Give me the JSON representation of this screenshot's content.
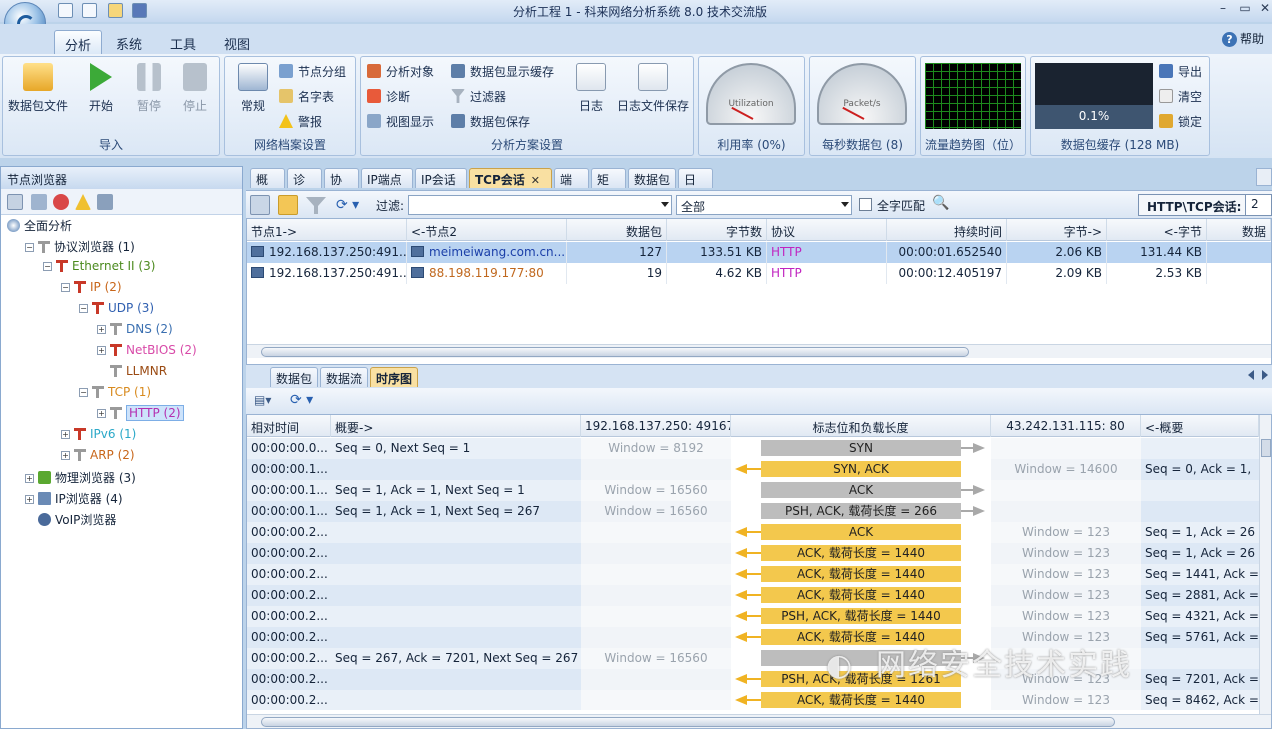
{
  "app": {
    "title": "分析工程 1 - 科来网络分析系统 8.0 技术交流版",
    "help": "帮助"
  },
  "ribbon_tabs": [
    "分析",
    "系统",
    "工具",
    "视图"
  ],
  "ribbon": {
    "import": {
      "label": "导入",
      "buttons": [
        "数据包文件",
        "开始",
        "暂停",
        "停止"
      ]
    },
    "profile": {
      "label": "网络档案设置",
      "big": "常规",
      "small": [
        "节点分组",
        "名字表",
        "警报"
      ]
    },
    "scheme": {
      "label": "分析方案设置",
      "col1": [
        "分析对象",
        "诊断",
        "视图显示"
      ],
      "col2": [
        "数据包显示缓存",
        "过滤器",
        "数据包保存"
      ],
      "big": [
        "日志",
        "日志文件保存"
      ]
    },
    "util": {
      "label": "利用率 (0%)",
      "gauge": "Utilization",
      "scale": [
        "0",
        "20",
        "40",
        "60",
        "80",
        "100"
      ],
      "value": 0
    },
    "pps": {
      "label": "每秒数据包 (8)",
      "gauge": "Packet/s",
      "scale": [
        "0",
        "500",
        "1K",
        "500K",
        "1M"
      ],
      "value": 8
    },
    "trend": {
      "label": "流量趋势图（位）"
    },
    "buffer": {
      "label": "数据包缓存 (128 MB)",
      "value": "0.1%",
      "fraction": 0.001,
      "actions": [
        "导出",
        "清空",
        "锁定"
      ]
    }
  },
  "left": {
    "title": "节点浏览器",
    "tree": [
      {
        "label": "全面分析",
        "level": 0,
        "icon": "globe-icon",
        "color": "#15243a",
        "ex": ""
      },
      {
        "label": "协议浏览器 (1)",
        "level": 1,
        "icon": "tee-icon",
        "color": "#15243a",
        "ex": "−"
      },
      {
        "label": "Ethernet II (3)",
        "level": 2,
        "icon": "tee-icon",
        "color": "#4b8a1e",
        "ex": "−"
      },
      {
        "label": "IP (2)",
        "level": 3,
        "icon": "tee-icon",
        "color": "#c8661a",
        "ex": "−"
      },
      {
        "label": "UDP (3)",
        "level": 4,
        "icon": "tee-icon",
        "color": "#2f5fb0",
        "ex": "−"
      },
      {
        "label": "DNS (2)",
        "level": 5,
        "icon": "tee-icon",
        "color": "#3a6fb0",
        "ex": "+"
      },
      {
        "label": "NetBIOS (2)",
        "level": 5,
        "icon": "tee-icon",
        "color": "#d84aa8",
        "ex": "+"
      },
      {
        "label": "LLMNR",
        "level": 5,
        "icon": "tee-icon",
        "color": "#9a4a12",
        "ex": ""
      },
      {
        "label": "TCP (1)",
        "level": 4,
        "icon": "tee-icon",
        "color": "#d88a1e",
        "ex": "−"
      },
      {
        "label": "HTTP (2)",
        "level": 5,
        "icon": "tee-icon",
        "color": "#b42fb0",
        "ex": "+",
        "selected": true
      },
      {
        "label": "IPv6 (1)",
        "level": 3,
        "icon": "tee-icon",
        "color": "#2aa8c8",
        "ex": "+"
      },
      {
        "label": "ARP (2)",
        "level": 3,
        "icon": "tee-icon",
        "color": "#c8661a",
        "ex": "+"
      },
      {
        "label": "物理浏览器 (3)",
        "level": 1,
        "icon": "chip-icon",
        "color": "#15243a",
        "ex": "+"
      },
      {
        "label": "IP浏览器 (4)",
        "level": 1,
        "icon": "pc-icon",
        "color": "#15243a",
        "ex": "+"
      },
      {
        "label": "VoIP浏览器",
        "level": 1,
        "icon": "phone-icon",
        "color": "#15243a",
        "ex": ""
      }
    ]
  },
  "tabs": [
    "概要",
    "诊断",
    "协议",
    "IP端点",
    "IP会话",
    "TCP会话",
    "端口",
    "矩阵",
    "数据包",
    "日志"
  ],
  "active_tab": "TCP会话",
  "filter": {
    "label": "过滤:",
    "value": "",
    "scope": "全部",
    "match_label": "全字匹配",
    "http_label": "HTTP\\TCP会话:",
    "http_count": "2"
  },
  "sessions": {
    "columns": [
      "节点1->",
      "<-节点2",
      "数据包",
      "字节数",
      "协议",
      "持续时间",
      "字节->",
      "<-字节",
      "数据"
    ],
    "rows": [
      {
        "node1": "192.168.137.250:491...",
        "node2": "meimeiwang.com.cn...",
        "packets": "127",
        "bytes": "133.51 KB",
        "proto": "HTTP",
        "duration": "00:00:01.652540",
        "b_out": "2.06 KB",
        "b_in": "131.44 KB",
        "selected": true,
        "n2color": "#1b3fa8"
      },
      {
        "node1": "192.168.137.250:491...",
        "node2": "88.198.119.177:80",
        "packets": "19",
        "bytes": "4.62 KB",
        "proto": "HTTP",
        "duration": "00:00:12.405197",
        "b_out": "2.09 KB",
        "b_in": "2.53 KB",
        "selected": false,
        "n2color": "#c0681e"
      }
    ]
  },
  "bottom_tabs": [
    "数据包",
    "数据流",
    "时序图"
  ],
  "active_bottom_tab": "时序图",
  "sequence": {
    "columns": [
      "相对时间",
      "概要->",
      "192.168.137.250: 49167",
      "标志位和负载长度",
      "43.242.131.115: 80",
      "<-概要"
    ],
    "rows": [
      {
        "t": "00:00:00.0...",
        "sum_out": "Seq = 0, Next Seq = 1",
        "win_l": "Window = 8192",
        "flag": "SYN",
        "dir": "r",
        "win_r": "",
        "sum_in": ""
      },
      {
        "t": "00:00:00.1...",
        "sum_out": "",
        "win_l": "",
        "flag": "SYN, ACK",
        "dir": "l",
        "win_r": "Window = 14600",
        "sum_in": "Seq = 0, Ack = 1,"
      },
      {
        "t": "00:00:00.1...",
        "sum_out": "Seq = 1, Ack = 1, Next Seq = 1",
        "win_l": "Window = 16560",
        "flag": "ACK",
        "dir": "r",
        "win_r": "",
        "sum_in": ""
      },
      {
        "t": "00:00:00.1...",
        "sum_out": "Seq = 1, Ack = 1, Next Seq = 267",
        "win_l": "Window = 16560",
        "flag": "PSH, ACK, 载荷长度 = 266",
        "dir": "r",
        "win_r": "",
        "sum_in": ""
      },
      {
        "t": "00:00:00.2...",
        "sum_out": "",
        "win_l": "",
        "flag": "ACK",
        "dir": "l",
        "win_r": "Window = 123",
        "sum_in": "Seq = 1, Ack = 26"
      },
      {
        "t": "00:00:00.2...",
        "sum_out": "",
        "win_l": "",
        "flag": "ACK, 载荷长度 = 1440",
        "dir": "l",
        "win_r": "Window = 123",
        "sum_in": "Seq = 1, Ack = 26"
      },
      {
        "t": "00:00:00.2...",
        "sum_out": "",
        "win_l": "",
        "flag": "ACK, 载荷长度 = 1440",
        "dir": "l",
        "win_r": "Window = 123",
        "sum_in": "Seq = 1441, Ack ="
      },
      {
        "t": "00:00:00.2...",
        "sum_out": "",
        "win_l": "",
        "flag": "ACK, 载荷长度 = 1440",
        "dir": "l",
        "win_r": "Window = 123",
        "sum_in": "Seq = 2881, Ack ="
      },
      {
        "t": "00:00:00.2...",
        "sum_out": "",
        "win_l": "",
        "flag": "PSH, ACK, 载荷长度 = 1440",
        "dir": "l",
        "win_r": "Window = 123",
        "sum_in": "Seq = 4321, Ack ="
      },
      {
        "t": "00:00:00.2...",
        "sum_out": "",
        "win_l": "",
        "flag": "ACK, 载荷长度 = 1440",
        "dir": "l",
        "win_r": "Window = 123",
        "sum_in": "Seq = 5761, Ack ="
      },
      {
        "t": "00:00:00.2...",
        "sum_out": "Seq = 267, Ack = 7201, Next Seq = 267",
        "win_l": "Window = 16560",
        "flag": "",
        "dir": "r",
        "win_r": "",
        "sum_in": ""
      },
      {
        "t": "00:00:00.2...",
        "sum_out": "",
        "win_l": "",
        "flag": "PSH, ACK, 载荷长度 = 1261",
        "dir": "l",
        "win_r": "Window = 123",
        "sum_in": "Seq = 7201, Ack ="
      },
      {
        "t": "00:00:00.2...",
        "sum_out": "",
        "win_l": "",
        "flag": "ACK, 载荷长度 = 1440",
        "dir": "l",
        "win_r": "Window = 123",
        "sum_in": "Seq = 8462, Ack ="
      }
    ]
  },
  "watermark": "网络安全技术实践"
}
